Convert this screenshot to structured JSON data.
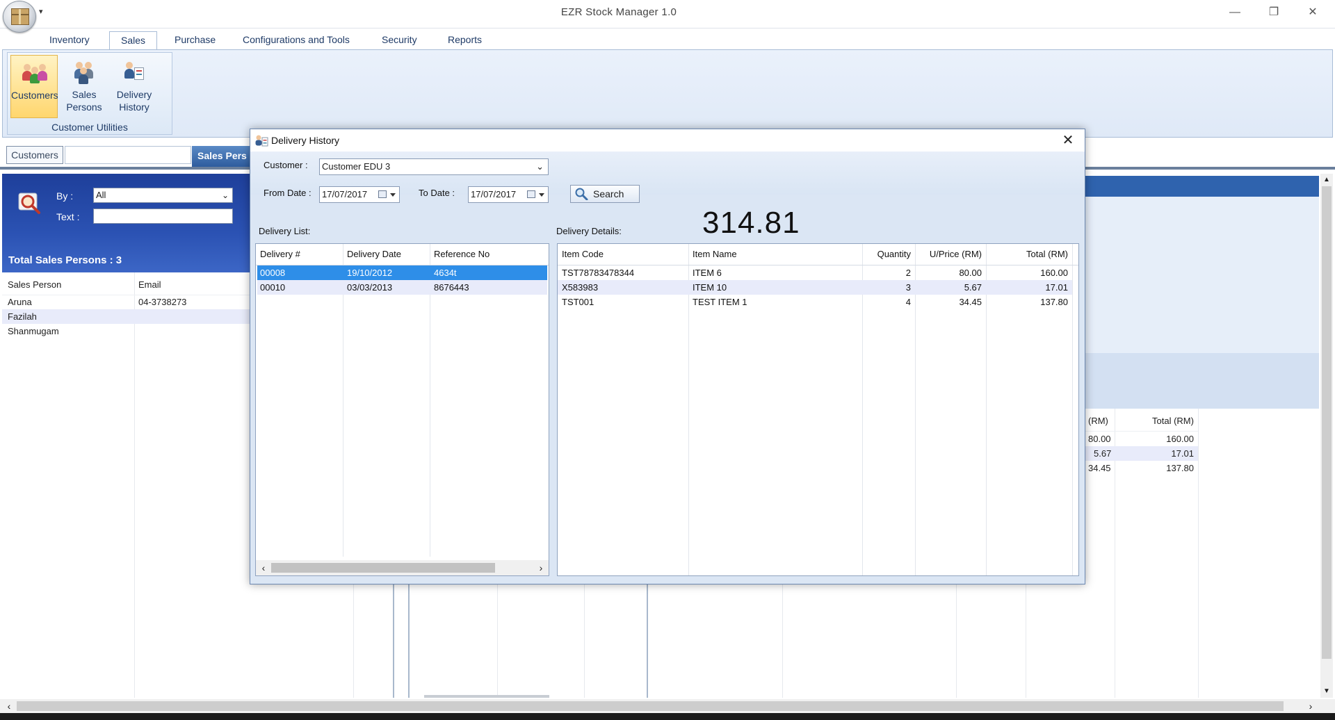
{
  "app": {
    "title": "EZR Stock Manager 1.0"
  },
  "ribbon": {
    "tabs": [
      "Inventory",
      "Sales",
      "Purchase",
      "Configurations and Tools",
      "Security",
      "Reports"
    ],
    "active_tab": "Sales",
    "buttons": [
      {
        "line1": "Customers",
        "line2": ""
      },
      {
        "line1": "Sales",
        "line2": "Persons"
      },
      {
        "line1": "Delivery",
        "line2": "History"
      }
    ],
    "group_label": "Customer Utilities"
  },
  "doc_tabs": {
    "customers": "Customers",
    "sales_persons": "Sales Pers"
  },
  "left_panel": {
    "by_label": "By :",
    "by_value": "All",
    "text_label": "Text :",
    "text_value": "",
    "total_label": "Total Sales Persons : 3",
    "columns": [
      "Sales Person",
      "Email"
    ],
    "rows": [
      [
        "Aruna",
        "04-3738273"
      ],
      [
        "Fazilah",
        ""
      ],
      [
        "Shanmugam",
        ""
      ]
    ]
  },
  "background_grid": {
    "columns": [
      "(RM)",
      "Total (RM)"
    ],
    "rows": [
      [
        "80.00",
        "160.00"
      ],
      [
        "5.67",
        "17.01"
      ],
      [
        "34.45",
        "137.80"
      ]
    ]
  },
  "dialog": {
    "title": "Delivery History",
    "customer_label": "Customer :",
    "customer_value": "Customer EDU 3",
    "from_label": "From Date :",
    "from_value": "17/07/2017",
    "to_label": "To Date :",
    "to_value": "17/07/2017",
    "search_label": "Search",
    "total_amount": "314.81",
    "list_label": "Delivery List:",
    "details_label": "Delivery Details:",
    "list_columns": [
      "Delivery #",
      "Delivery Date",
      "Reference No"
    ],
    "list_rows": [
      [
        "00008",
        "19/10/2012",
        "4634t"
      ],
      [
        "00010",
        "03/03/2013",
        "8676443"
      ]
    ],
    "detail_columns": [
      "Item Code",
      "Item Name",
      "Quantity",
      "U/Price (RM)",
      "Total (RM)"
    ],
    "detail_rows": [
      [
        "TST78783478344",
        "ITEM 6",
        "2",
        "80.00",
        "160.00"
      ],
      [
        "X583983",
        "ITEM 10",
        "3",
        "5.67",
        "17.01"
      ],
      [
        "TST001",
        "TEST ITEM 1",
        "4",
        "34.45",
        "137.80"
      ]
    ]
  }
}
